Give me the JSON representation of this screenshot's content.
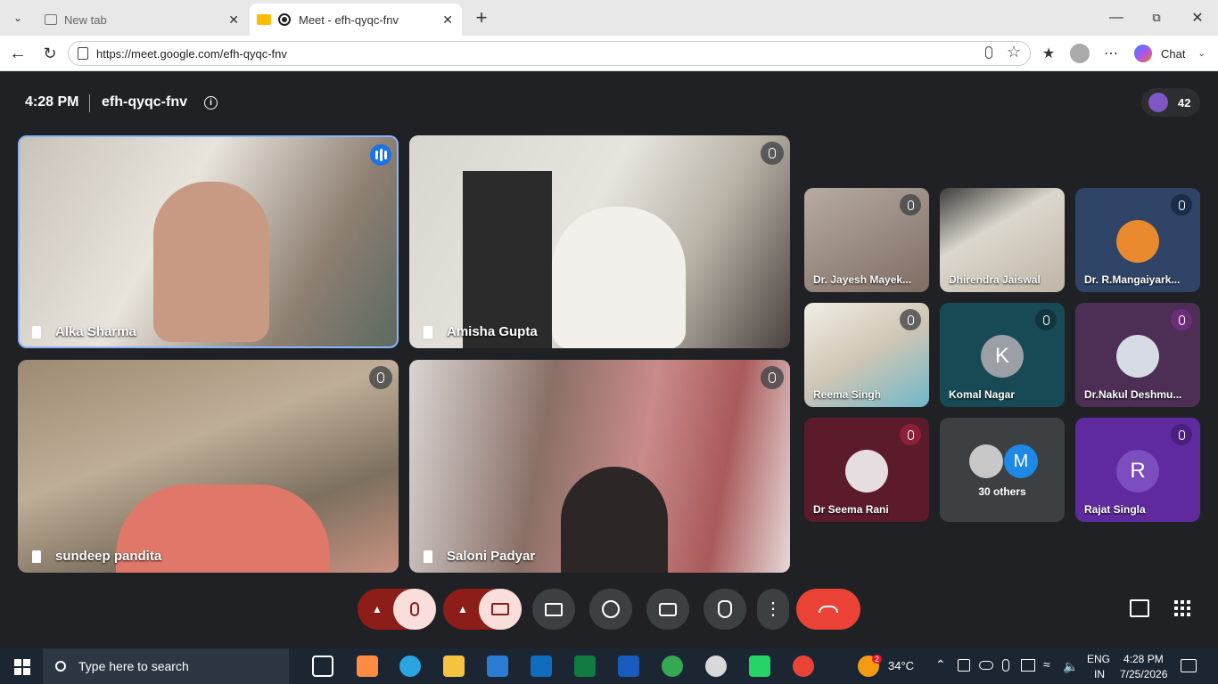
{
  "browser": {
    "tabs": [
      {
        "title": "New tab"
      },
      {
        "title": "Meet - efh-qyqc-fnv"
      }
    ],
    "url": "https://meet.google.com/efh-qyqc-fnv",
    "chat_label": "Chat"
  },
  "meeting": {
    "time": "4:28 PM",
    "code": "efh-qyqc-fnv",
    "participant_count": "42",
    "main_tiles": [
      {
        "name": "Alka Sharma"
      },
      {
        "name": "Amisha Gupta"
      },
      {
        "name": "sundeep pandita"
      },
      {
        "name": "Saloni Padyar"
      }
    ],
    "side_tiles": [
      {
        "name": "Dr. Jayesh Mayek..."
      },
      {
        "name": "Dhirendra Jaiswal"
      },
      {
        "name": "Dr. R.Mangaiyark..."
      },
      {
        "name": "Reema Singh"
      },
      {
        "name": "Komal Nagar",
        "initial": "K"
      },
      {
        "name": "Dr.Nakul Deshmu..."
      },
      {
        "name": "Dr Seema Rani"
      },
      {
        "name": "30 others",
        "initial": "M"
      },
      {
        "name": "Rajat Singla",
        "initial": "R"
      }
    ]
  },
  "taskbar": {
    "search_placeholder": "Type here to search",
    "weather": "34°C",
    "weather_badge": "2",
    "lang": "ENG",
    "region": "IN",
    "time": "4:28 PM",
    "date": "7/25/2026"
  },
  "colors": {
    "meet_bg": "#202124",
    "hangup": "#ea4335",
    "muted_btn": "#f9dedc",
    "muted_caret": "#8c1d18",
    "active_border": "#8ab4f8"
  }
}
